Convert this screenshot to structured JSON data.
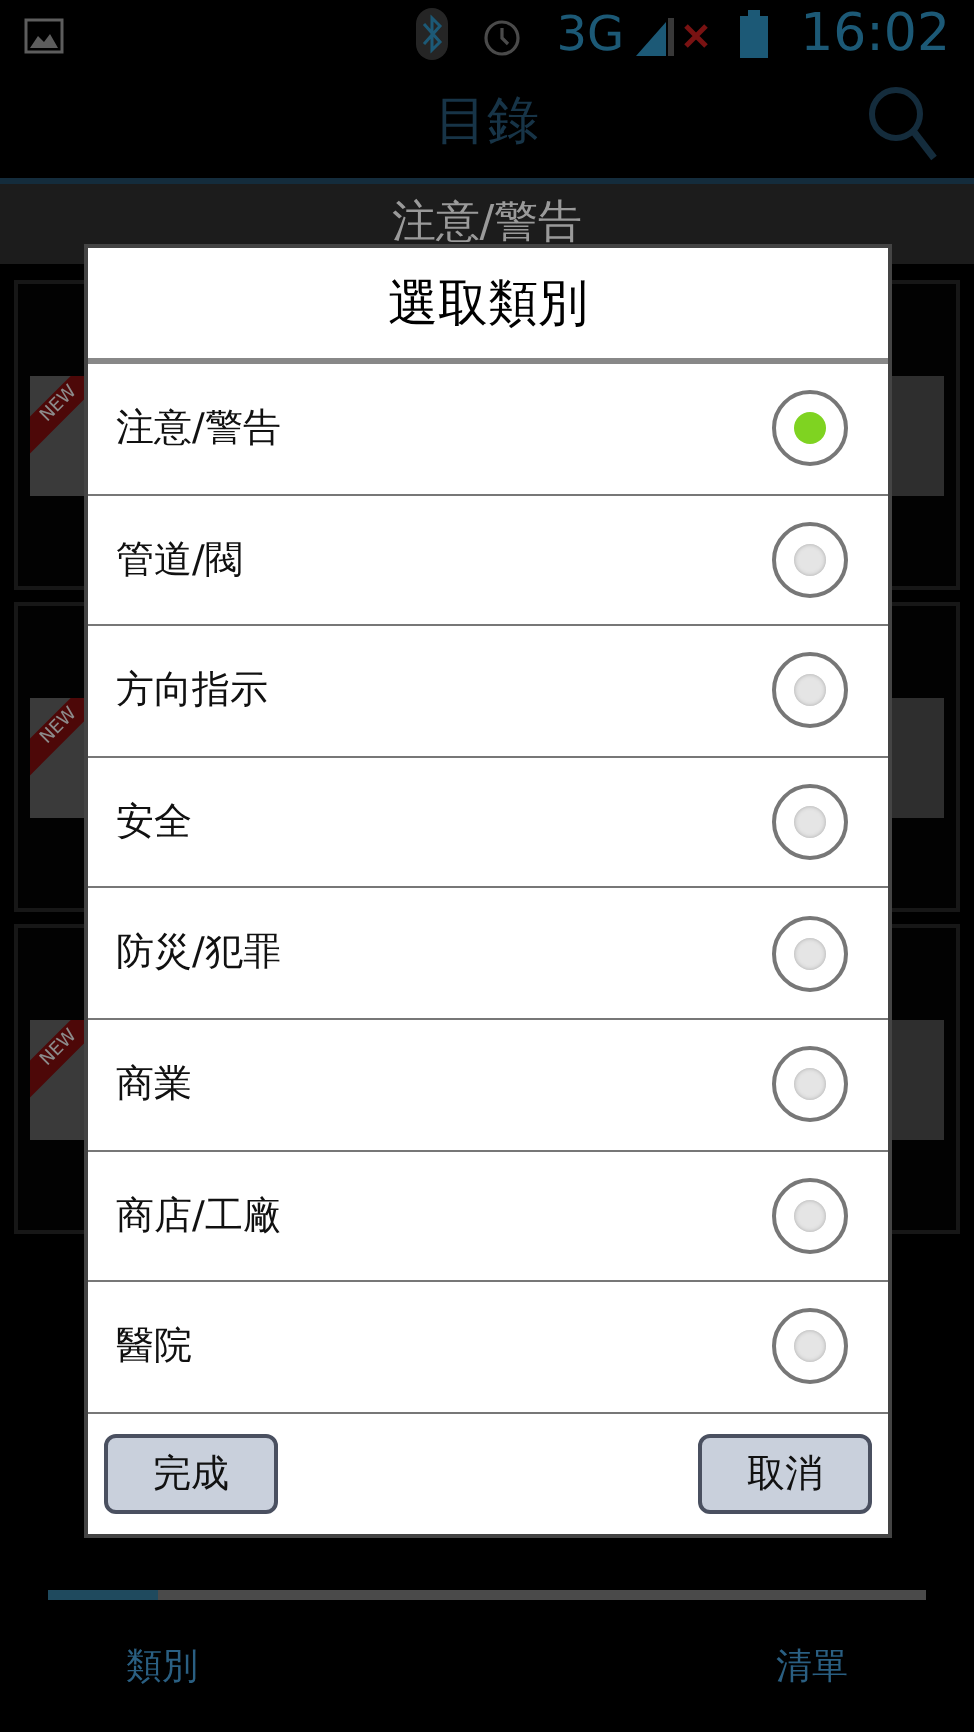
{
  "status_bar": {
    "network": "3G",
    "time": "16:02"
  },
  "app_bar": {
    "title": "目錄"
  },
  "section_header": {
    "title": "注意/警告"
  },
  "cards": [
    {
      "badge": "NEW"
    },
    {
      "badge": "NEW"
    },
    {
      "badge": "NEW"
    }
  ],
  "dialog": {
    "title": "選取類別",
    "options": [
      {
        "label": "注意/警告",
        "selected": true
      },
      {
        "label": "管道/閥",
        "selected": false
      },
      {
        "label": "方向指示",
        "selected": false
      },
      {
        "label": "安全",
        "selected": false
      },
      {
        "label": "防災/犯罪",
        "selected": false
      },
      {
        "label": "商業",
        "selected": false
      },
      {
        "label": "商店/工廠",
        "selected": false
      },
      {
        "label": "醫院",
        "selected": false
      }
    ],
    "buttons": [
      "完成",
      "取消"
    ]
  },
  "pager": {
    "level": 0.125
  },
  "bottom_tabs": [
    {
      "label": "類別"
    },
    {
      "label": "清單"
    }
  ]
}
